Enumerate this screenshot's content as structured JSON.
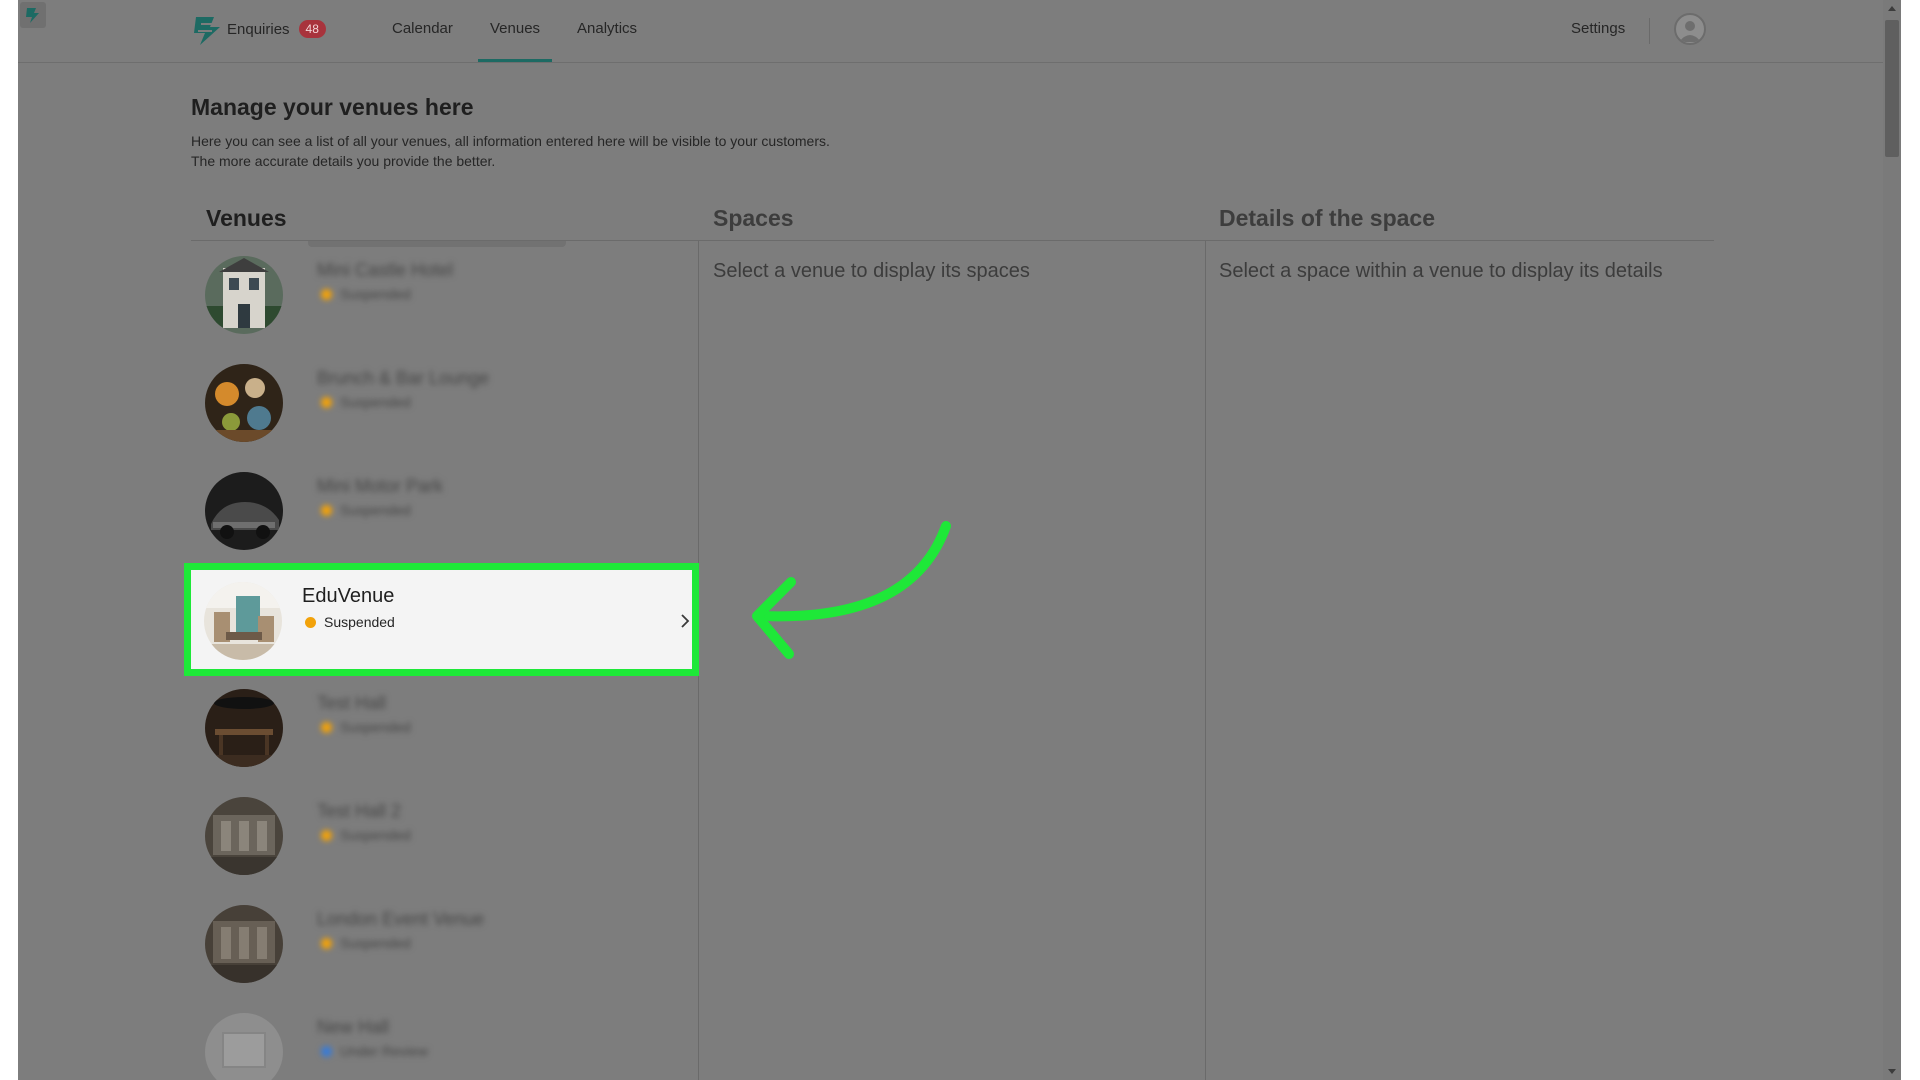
{
  "header": {
    "nav": [
      {
        "label": "Enquiries",
        "badge": "48",
        "active": false
      },
      {
        "label": "Calendar",
        "active": false
      },
      {
        "label": "Venues",
        "active": true
      },
      {
        "label": "Analytics",
        "active": false
      }
    ],
    "settings_label": "Settings",
    "icons": {
      "logo": "brand-logo-icon",
      "avatar": "user-avatar-icon"
    }
  },
  "intro": {
    "title": "Manage your venues here",
    "line1": "Here you can see a list of all your venues, all information entered here will be visible to your customers.",
    "line2": "The more accurate details you provide the better."
  },
  "columns": {
    "venues": "Venues",
    "spaces": "Spaces",
    "details": "Details of the space",
    "spaces_empty": "Select a venue to display its spaces",
    "details_empty": "Select a space within a venue to display its details"
  },
  "venues": [
    {
      "name": "Mini Castle Hotel",
      "status": "Suspended"
    },
    {
      "name": "Brunch & Bar Lounge",
      "status": "Suspended"
    },
    {
      "name": "Mini Motor Park",
      "status": "Suspended"
    },
    {
      "name": "EduVenue",
      "status": "Suspended",
      "selected": true
    },
    {
      "name": "Test Hall",
      "status": "Suspended"
    },
    {
      "name": "Test Hall 2",
      "status": "Suspended"
    },
    {
      "name": "London Event Venue",
      "status": "Suspended"
    },
    {
      "name": "New Hall",
      "status": "Under Review"
    }
  ],
  "colors": {
    "accent": "#1d6a63",
    "badge": "#a8333c",
    "highlight": "#1ee838",
    "status_suspended": "#f2a20a",
    "status_review": "#3a7bd5"
  }
}
